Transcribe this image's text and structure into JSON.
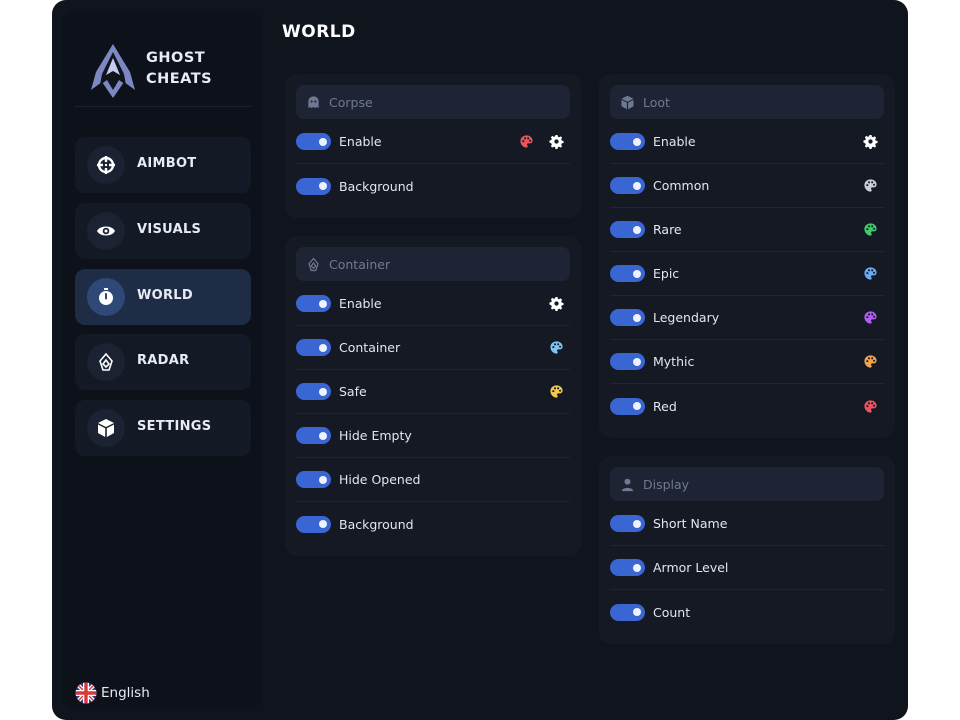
{
  "brand": {
    "name": "GHOST\nCHEATS"
  },
  "nav": {
    "items": [
      {
        "label": "AIMBOT",
        "icon": "crosshair-icon"
      },
      {
        "label": "VISUALS",
        "icon": "eye-icon"
      },
      {
        "label": "WORLD",
        "icon": "stopwatch-icon",
        "active": true
      },
      {
        "label": "RADAR",
        "icon": "radar-icon"
      },
      {
        "label": "SETTINGS",
        "icon": "cube-icon"
      }
    ]
  },
  "language": {
    "label": "English",
    "icon": "uk-flag-icon"
  },
  "page": {
    "title": "WORLD"
  },
  "colors": {
    "accent": "#3a66d4",
    "corpse_enable_color": "#e8555f",
    "container_color": "#7fc4f0",
    "safe_color": "#f2c94c",
    "common_color": "#c9cdd6",
    "rare_color": "#3fca6b",
    "epic_color": "#6aa8f0",
    "legendary_color": "#b15cf2",
    "mythic_color": "#f2a34c",
    "red_color": "#e8555f"
  },
  "corpse": {
    "title": "Corpse",
    "icon": "ghost-icon",
    "rows": [
      {
        "label": "Enable",
        "enabled": true,
        "icons": [
          "palette-icon",
          "gear-icon"
        ]
      },
      {
        "label": "Background",
        "enabled": true,
        "icons": []
      }
    ]
  },
  "container": {
    "title": "Container",
    "icon": "radar-icon",
    "rows": [
      {
        "label": "Enable",
        "enabled": true,
        "icons": [
          "gear-icon"
        ]
      },
      {
        "label": "Container",
        "enabled": true,
        "icons": [
          "palette-icon"
        ]
      },
      {
        "label": "Safe",
        "enabled": true,
        "icons": [
          "palette-icon"
        ]
      },
      {
        "label": "Hide Empty",
        "enabled": true,
        "icons": []
      },
      {
        "label": "Hide Opened",
        "enabled": true,
        "icons": []
      },
      {
        "label": "Background",
        "enabled": true,
        "icons": []
      }
    ]
  },
  "loot": {
    "title": "Loot",
    "icon": "cube-icon",
    "rows": [
      {
        "label": "Enable",
        "enabled": true,
        "icons": [
          "gear-icon"
        ]
      },
      {
        "label": "Common",
        "enabled": true,
        "icons": [
          "palette-icon"
        ]
      },
      {
        "label": "Rare",
        "enabled": true,
        "icons": [
          "palette-icon"
        ]
      },
      {
        "label": "Epic",
        "enabled": true,
        "icons": [
          "palette-icon"
        ]
      },
      {
        "label": "Legendary",
        "enabled": true,
        "icons": [
          "palette-icon"
        ]
      },
      {
        "label": "Mythic",
        "enabled": true,
        "icons": [
          "palette-icon"
        ]
      },
      {
        "label": "Red",
        "enabled": true,
        "icons": [
          "palette-icon"
        ]
      }
    ]
  },
  "display": {
    "title": "Display",
    "icon": "user-icon",
    "rows": [
      {
        "label": "Short Name",
        "enabled": true,
        "icons": []
      },
      {
        "label": "Armor Level",
        "enabled": true,
        "icons": []
      },
      {
        "label": "Count",
        "enabled": true,
        "icons": []
      }
    ]
  }
}
